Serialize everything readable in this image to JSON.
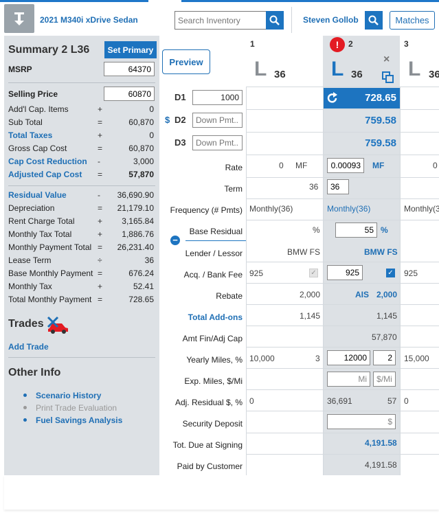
{
  "header": {
    "vehicle": "2021 M340i xDrive Sedan",
    "search_placeholder": "Search Inventory",
    "user": "Steven Gollob",
    "matches_label": "Matches"
  },
  "summary": {
    "title": "Summary 2 L36",
    "set_primary": "Set Primary",
    "msrp_label": "MSRP",
    "msrp_value": "64370",
    "selling_label": "Selling Price",
    "selling_value": "60870",
    "rows1": [
      {
        "label": "Add'l Cap. Items",
        "op": "+",
        "value": "0",
        "style": ""
      },
      {
        "label": "Sub Total",
        "op": "=",
        "value": "60,870",
        "style": ""
      },
      {
        "label": "Total Taxes",
        "op": "+",
        "value": "0",
        "style": "blue"
      },
      {
        "label": "Gross Cap Cost",
        "op": "=",
        "value": "60,870",
        "style": ""
      },
      {
        "label": "Cap Cost Reduction",
        "op": "-",
        "value": "3,000",
        "style": "blue"
      },
      {
        "label": "Adjusted Cap Cost",
        "op": "=",
        "value": "57,870",
        "style": "blue"
      }
    ],
    "rows2": [
      {
        "label": "Residual Value",
        "op": "-",
        "value": "36,690.90",
        "style": "blue"
      },
      {
        "label": "Depreciation",
        "op": "=",
        "value": "21,179.10",
        "style": ""
      },
      {
        "label": "Rent Charge Total",
        "op": "+",
        "value": "3,165.84",
        "style": ""
      },
      {
        "label": "Monthly Tax Total",
        "op": "+",
        "value": "1,886.76",
        "style": ""
      },
      {
        "label": "Monthly Payment Total",
        "op": "=",
        "value": "26,231.40",
        "style": ""
      },
      {
        "label": "Lease Term",
        "op": "÷",
        "value": "36",
        "style": ""
      },
      {
        "label": "Base Monthly Payment",
        "op": "=",
        "value": "676.24",
        "style": ""
      },
      {
        "label": "Monthly Tax",
        "op": "+",
        "value": "52.41",
        "style": ""
      },
      {
        "label": "Total Monthly Payment",
        "op": "=",
        "value": "728.65",
        "style": ""
      }
    ]
  },
  "trades": {
    "title": "Trades",
    "add_trade": "Add Trade"
  },
  "other_info": {
    "title": "Other Info",
    "links": [
      {
        "label": "Scenario History",
        "enabled": true
      },
      {
        "label": "Print Trade Evaluation",
        "enabled": false
      },
      {
        "label": "Fuel Savings Analysis",
        "enabled": true
      }
    ]
  },
  "middle": {
    "preview": "Preview",
    "d1_label": "D1",
    "d1_value": "1000",
    "d2_prefix": "$",
    "d2_label": "D2",
    "d3_label": "D3",
    "down_placeholder": "Down Pmt...",
    "row_labels": [
      "Rate",
      "Term",
      "Frequency (# Pmts)",
      "Base Residual",
      "Lender / Lessor",
      "Acq. / Bank Fee",
      "Rebate",
      "Total Add-ons",
      "Amt Fin/Adj Cap",
      "Yearly Miles, %",
      "Exp. Miles, $/Mi",
      "Adj. Residual $, %",
      "Security Deposit",
      "Tot. Due at Signing",
      "Paid by Customer"
    ]
  },
  "columns": [
    {
      "number": "1",
      "letter": "L",
      "term": "36",
      "d1": "",
      "d2": "",
      "d3": "",
      "rate": "0",
      "rate_unit": "MF",
      "term_val": "36",
      "frequency": "Monthly(36)",
      "residual_pct": "%",
      "lender": "BMW FS",
      "fee": "925",
      "rebate": "2,000",
      "addons": "1,145",
      "amt_fin": "",
      "miles": "10,000",
      "miles_pct": "3",
      "adj_residual": "0"
    },
    {
      "number": "2",
      "alert": "!",
      "letter": "L",
      "term": "36",
      "d1": "728.65",
      "d2": "759.58",
      "d3": "759.58",
      "rate": "0.00093",
      "rate_unit": "MF",
      "term_val": "36",
      "frequency": "Monthly(36)",
      "residual_pct": "55",
      "residual_unit": "%",
      "lender": "BMW FS",
      "fee": "925",
      "rebate_prefix": "AIS",
      "rebate": "2,000",
      "addons": "1,145",
      "amt_fin": "57,870",
      "miles": "12000",
      "miles_pct": "2",
      "miles_unit": "Mi",
      "per_mile_unit": "$/Mi",
      "adj_residual": "36,691",
      "adj_residual_pct": "57",
      "deposit_unit": "$",
      "due_signing": "4,191.58",
      "paid_customer": "4,191.58"
    },
    {
      "number": "3",
      "letter": "L",
      "term": "36",
      "rate": "0",
      "frequency": "Monthly(3",
      "fee": "925",
      "miles": "15,000",
      "adj_residual": "0"
    }
  ],
  "colors": {
    "accent": "#1d74c0",
    "panel": "#dde1e5",
    "alert": "#e31b23"
  }
}
